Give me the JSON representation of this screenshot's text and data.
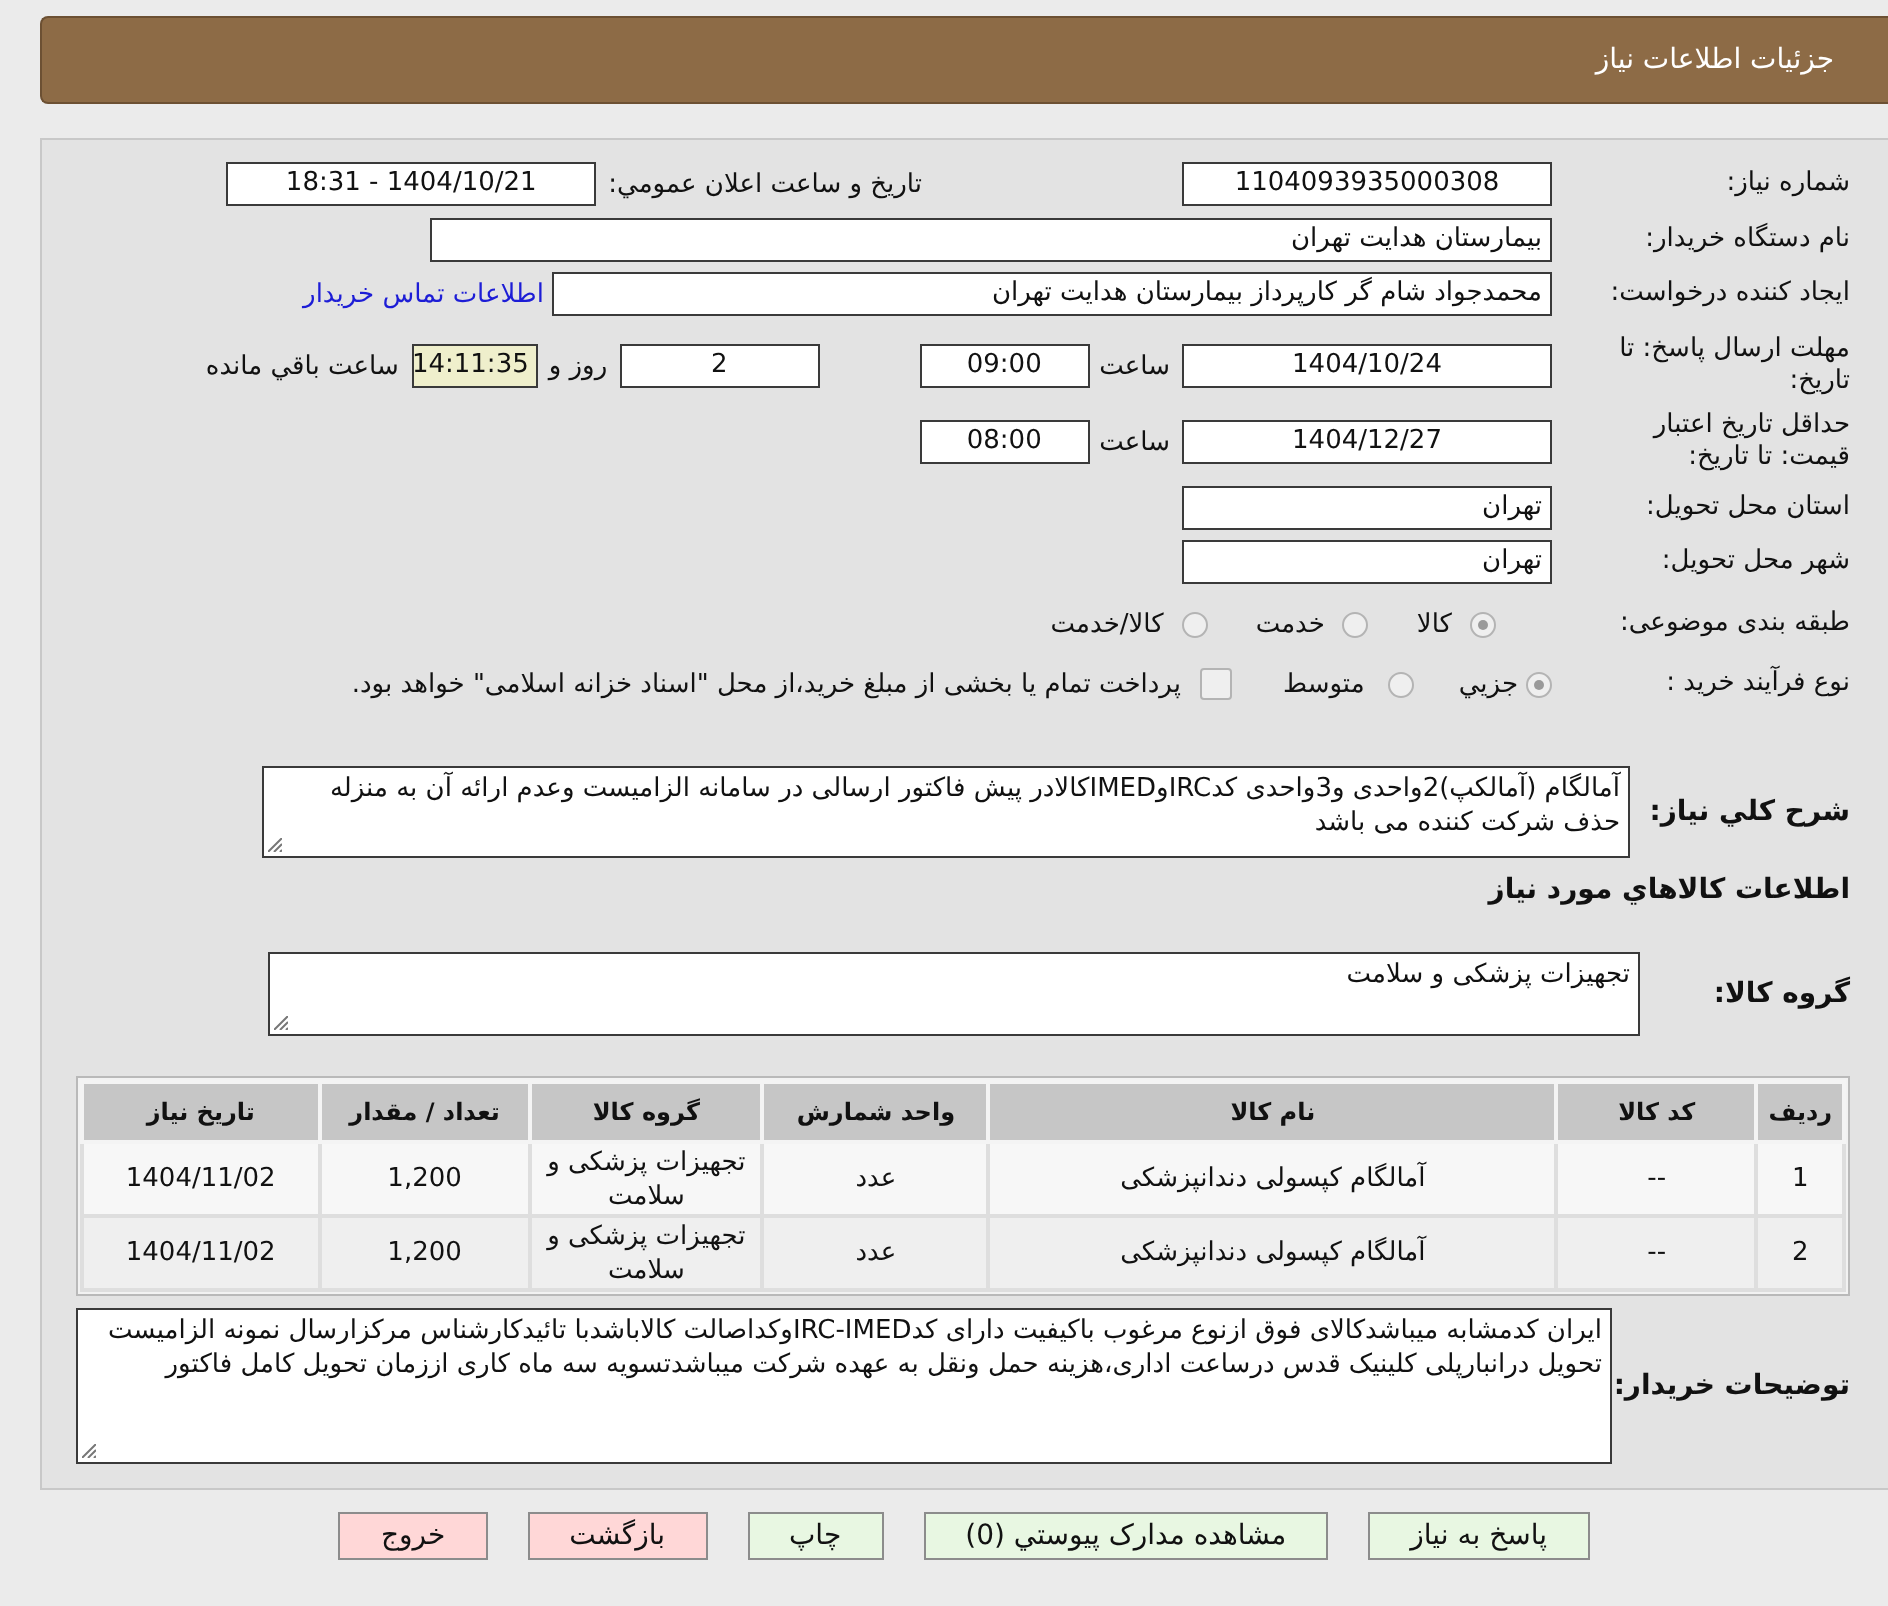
{
  "header": {
    "title": "جزئیات اطلاعات نیاز"
  },
  "need_number": {
    "label": "شماره نیاز:",
    "value": "1104093935000308"
  },
  "announce_datetime": {
    "label": "تاریخ و ساعت اعلان عمومي:",
    "value": "1404/10/21 - 18:31"
  },
  "buyer_org": {
    "label": "نام دستگاه خریدار:",
    "value": "بیمارستان هدایت تهران"
  },
  "requester": {
    "label": "ایجاد کننده درخواست:",
    "value": "محمدجواد شام گر کارپرداز بیمارستان هدایت تهران",
    "link": "اطلاعات تماس خریدار"
  },
  "response_deadline": {
    "label": "مهلت ارسال پاسخ: تا تاریخ:",
    "date": "1404/10/24",
    "time_label": "ساعت",
    "time": "09:00",
    "days": "2",
    "days_label": "روز و",
    "remaining": "14:11:35",
    "remaining_label": "ساعت باقي مانده"
  },
  "price_validity": {
    "label": "حداقل تاریخ اعتبار قیمت: تا تاریخ:",
    "date": "1404/12/27",
    "time_label": "ساعت",
    "time": "08:00"
  },
  "delivery_province": {
    "label": "استان محل تحویل:",
    "value": "تهران"
  },
  "delivery_city": {
    "label": "شهر محل تحویل:",
    "value": "تهران"
  },
  "subject_category": {
    "label": "طبقه بندی موضوعی:",
    "options": [
      {
        "label": "کالا",
        "selected": true
      },
      {
        "label": "خدمت",
        "selected": false
      },
      {
        "label": "کالا/خدمت",
        "selected": false
      }
    ]
  },
  "purchase_process": {
    "label": "نوع فرآیند خرید :",
    "options": [
      {
        "label": "جزيي",
        "selected": true
      },
      {
        "label": "متوسط",
        "selected": false
      }
    ],
    "treasury_payment": {
      "checked": false,
      "label": "پرداخت تمام یا بخشی از مبلغ خرید،از محل \"اسناد خزانه اسلامی\" خواهد بود."
    }
  },
  "general_description": {
    "label": "شرح کلي نیاز:",
    "value": "آمالگام (آمالکپ)2واحدی و3واحدی کدIRCوIMEDکالادر پیش فاکتور ارسالی در سامانه الزامیست وعدم ارائه آن به منزله حذف شرکت کننده می باشد"
  },
  "items_section": {
    "title": "اطلاعات کالاهاي مورد نیاز"
  },
  "goods_group": {
    "label": "گروه کالا:",
    "value": "تجهیزات پزشکی و سلامت"
  },
  "table": {
    "columns": [
      "ردیف",
      "کد کالا",
      "نام کالا",
      "واحد شمارش",
      "گروه کالا",
      "تعداد / مقدار",
      "تاریخ نیاز"
    ],
    "rows": [
      [
        "1",
        "--",
        "آمالگام کپسولی دندانپزشکی",
        "عدد",
        "تجهیزات پزشکی و سلامت",
        "1,200",
        "1404/11/02"
      ],
      [
        "2",
        "--",
        "آمالگام کپسولی دندانپزشکی",
        "عدد",
        "تجهیزات پزشکی و سلامت",
        "1,200",
        "1404/11/02"
      ]
    ]
  },
  "buyer_notes": {
    "label": "توضیحات خریدار:",
    "value": "ایران کدمشابه میباشدکالای فوق ازنوع مرغوب باکیفیت دارای کدIRC-IMEDوکداصالت کالاباشدبا تائیدکارشناس مرکزارسال نمونه الزامیست تحویل درانبارپلی کلینیک قدس درساعت اداری،هزینه حمل ونقل به عهده شرکت میباشدتسویه سه ماه کاری اززمان تحویل کامل فاکتور"
  },
  "buttons": [
    {
      "label": "پاسخ به نیاز",
      "kind": "primary"
    },
    {
      "label": "مشاهده مدارک پیوستي (0)",
      "kind": "primary"
    },
    {
      "label": "چاپ",
      "kind": "primary"
    },
    {
      "label": "بازگشت",
      "kind": "danger"
    },
    {
      "label": "خروج",
      "kind": "danger"
    }
  ]
}
